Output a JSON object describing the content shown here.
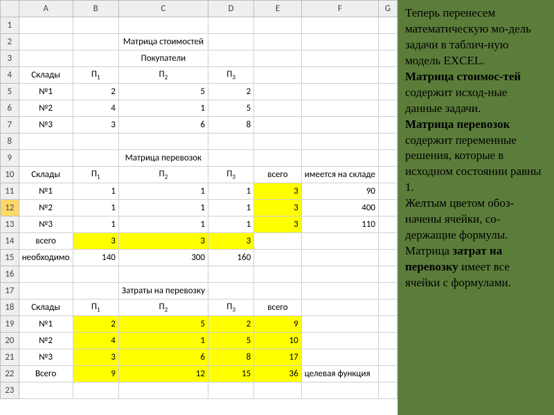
{
  "columns": [
    "A",
    "B",
    "C",
    "D",
    "E",
    "F",
    "G"
  ],
  "titles": {
    "cost_matrix": "Матрица стоимостей",
    "buyers": "Покупатели",
    "transport_matrix": "Матрица перевозок",
    "expense_matrix": "Затраты на перевозку"
  },
  "labels": {
    "warehouses": "Склады",
    "p1": "П₁",
    "p2": "П₂",
    "p3": "П₃",
    "n1": "№1",
    "n2": "№2",
    "n3": "№3",
    "total": "всего",
    "total_cap": "Всего",
    "in_stock": "имеется на складе",
    "needed": "необходимо",
    "objective": "целевая функция"
  },
  "cost": {
    "rows": [
      {
        "name": "№1",
        "v": [
          2,
          5,
          2
        ]
      },
      {
        "name": "№2",
        "v": [
          4,
          1,
          5
        ]
      },
      {
        "name": "№3",
        "v": [
          3,
          6,
          8
        ]
      }
    ]
  },
  "transport": {
    "rows": [
      {
        "name": "№1",
        "v": [
          1,
          1,
          1
        ],
        "sum": 3,
        "stock": 90
      },
      {
        "name": "№2",
        "v": [
          1,
          1,
          1
        ],
        "sum": 3,
        "stock": 400
      },
      {
        "name": "№3",
        "v": [
          1,
          1,
          1
        ],
        "sum": 3,
        "stock": 110
      }
    ],
    "col_totals": [
      3,
      3,
      3
    ],
    "needed": [
      140,
      300,
      160
    ]
  },
  "expense": {
    "rows": [
      {
        "name": "№1",
        "v": [
          2,
          5,
          2
        ],
        "sum": 9
      },
      {
        "name": "№2",
        "v": [
          4,
          1,
          5
        ],
        "sum": 10
      },
      {
        "name": "№3",
        "v": [
          3,
          6,
          8
        ],
        "sum": 17
      }
    ],
    "col_totals": [
      9,
      12,
      15
    ],
    "grand_total": 36
  },
  "sidetext": {
    "p1": "Теперь перенесем математическую мо-дель задачи в таблич-ную модель EXCEL.",
    "p2a": "Матрица стоимос-тей",
    "p2b": " содержит исход-ные данные задачи.",
    "p3a": "Матрица перевозок",
    "p3b": " содержит переменные решения, которые в исходном состоянии равны 1.",
    "p4": "Желтым цветом обоз-начены ячейки, со-держащие формулы.",
    "p5a": "Матрица ",
    "p5b": "затрат на перевозку",
    "p5c": " имеет все ячейки с формулами."
  }
}
